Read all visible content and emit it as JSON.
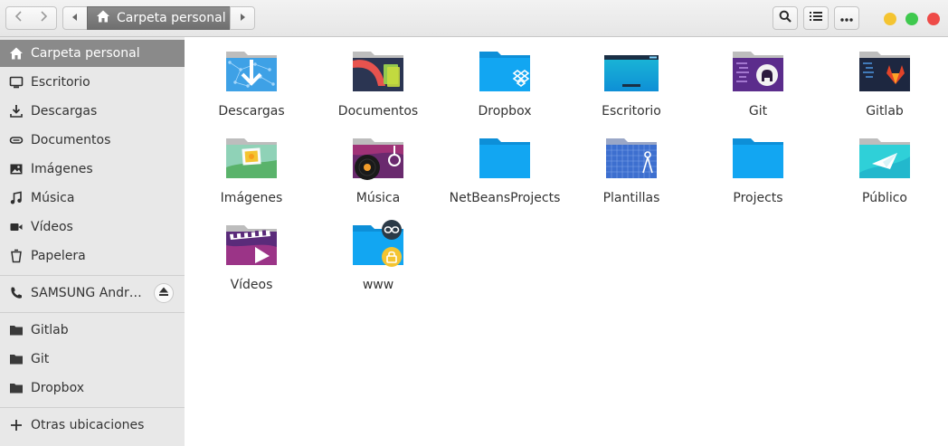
{
  "header": {
    "path_current": "Carpeta personal"
  },
  "sidebar": {
    "places": [
      {
        "label": "Carpeta personal",
        "icon": "home-icon",
        "active": true
      },
      {
        "label": "Escritorio",
        "icon": "desktop-icon"
      },
      {
        "label": "Descargas",
        "icon": "download-icon"
      },
      {
        "label": "Documentos",
        "icon": "document-icon"
      },
      {
        "label": "Imágenes",
        "icon": "image-icon"
      },
      {
        "label": "Música",
        "icon": "music-icon"
      },
      {
        "label": "Vídeos",
        "icon": "video-icon"
      },
      {
        "label": "Papelera",
        "icon": "trash-icon"
      }
    ],
    "devices": [
      {
        "label": "SAMSUNG Andr…",
        "icon": "phone-icon"
      }
    ],
    "bookmarks": [
      {
        "label": "Gitlab",
        "icon": "folder-icon"
      },
      {
        "label": "Git",
        "icon": "folder-icon"
      },
      {
        "label": "Dropbox",
        "icon": "folder-icon"
      }
    ],
    "other": {
      "label": "Otras ubicaciones",
      "icon": "plus-icon"
    }
  },
  "files": [
    {
      "name": "Descargas"
    },
    {
      "name": "Documentos"
    },
    {
      "name": "Dropbox"
    },
    {
      "name": "Escritorio"
    },
    {
      "name": "Git"
    },
    {
      "name": "Gitlab"
    },
    {
      "name": "Imágenes"
    },
    {
      "name": "Música"
    },
    {
      "name": "NetBeansProjects"
    },
    {
      "name": "Plantillas"
    },
    {
      "name": "Projects"
    },
    {
      "name": "Público"
    },
    {
      "name": "Vídeos"
    },
    {
      "name": "www"
    }
  ],
  "colors": {
    "folder_blue": "#12a6f2",
    "sidebar_bg": "#e8e8e8",
    "active_bg": "#8a8a8a"
  }
}
